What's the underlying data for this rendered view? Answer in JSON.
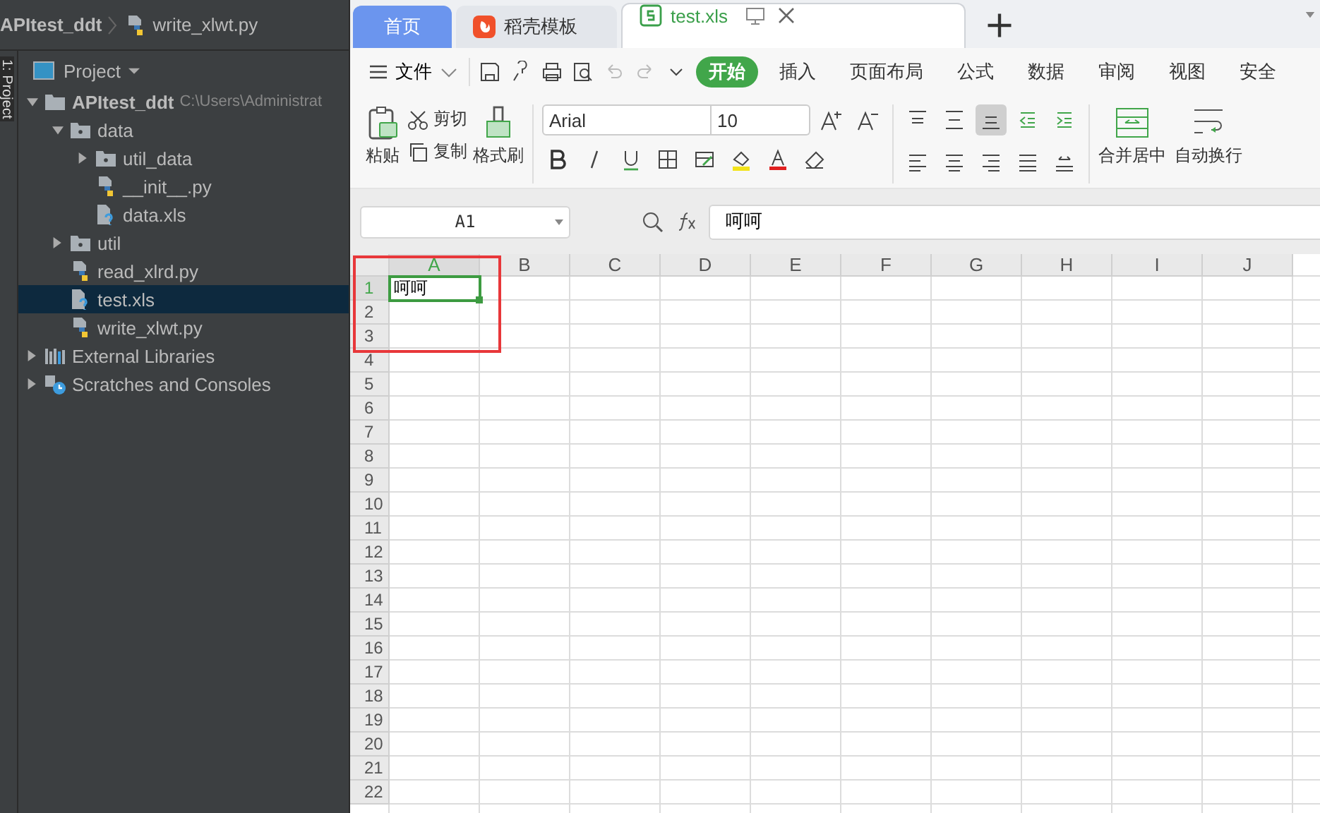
{
  "ide": {
    "breadcrumb": [
      "APItest_ddt",
      "write_xlwt.py"
    ],
    "side_tab": "1: Project",
    "panel_title": "Project",
    "tree": [
      {
        "label": "APItest_ddt",
        "kind": "project",
        "path": "C:\\Users\\Administrat",
        "expanded": true,
        "selected": false,
        "children": [
          {
            "label": "data",
            "kind": "folder",
            "expanded": true,
            "selected": false,
            "children": [
              {
                "label": "util_data",
                "kind": "folder",
                "expanded": false,
                "selected": false
              },
              {
                "label": "__init__.py",
                "kind": "python",
                "selected": false
              },
              {
                "label": "data.xls",
                "kind": "unknown",
                "selected": false
              }
            ]
          },
          {
            "label": "util",
            "kind": "folder",
            "expanded": false,
            "selected": false
          },
          {
            "label": "read_xlrd.py",
            "kind": "python",
            "selected": false
          },
          {
            "label": "test.xls",
            "kind": "unknown",
            "selected": true
          },
          {
            "label": "write_xlwt.py",
            "kind": "python",
            "selected": false
          }
        ]
      },
      {
        "label": "External Libraries",
        "kind": "libraries",
        "expanded": false,
        "selected": false
      },
      {
        "label": "Scratches and Consoles",
        "kind": "scratches",
        "expanded": false,
        "selected": false
      }
    ]
  },
  "wps": {
    "tabs": [
      {
        "label": "首页",
        "kind": "home",
        "selected": false
      },
      {
        "label": "稻壳模板",
        "kind": "template",
        "selected": false
      },
      {
        "label": "test.xls",
        "kind": "sheet",
        "selected": true
      }
    ],
    "file_menu": "文件",
    "ribbon_tabs": [
      {
        "label": "开始",
        "selected": true
      },
      {
        "label": "插入",
        "selected": false
      },
      {
        "label": "页面布局",
        "selected": false
      },
      {
        "label": "公式",
        "selected": false
      },
      {
        "label": "数据",
        "selected": false
      },
      {
        "label": "审阅",
        "selected": false
      },
      {
        "label": "视图",
        "selected": false
      },
      {
        "label": "安全",
        "selected": false
      }
    ],
    "clipboard": {
      "paste": "粘贴",
      "cut": "剪切",
      "copy": "复制",
      "format_painter": "格式刷"
    },
    "font": {
      "name": "Arial",
      "size": "10"
    },
    "align_buttons": [
      {
        "kind": "top",
        "selected": false
      },
      {
        "kind": "middle",
        "selected": false
      },
      {
        "kind": "bottom",
        "selected": true
      },
      {
        "kind": "outdent",
        "selected": false
      },
      {
        "kind": "indent",
        "selected": false
      },
      {
        "kind": "left",
        "selected": false
      },
      {
        "kind": "center",
        "selected": false
      },
      {
        "kind": "right",
        "selected": false
      },
      {
        "kind": "justify",
        "selected": false
      },
      {
        "kind": "distribute",
        "selected": false
      }
    ],
    "merge": "合并居中",
    "wrap": "自动换行",
    "name_box": "A1",
    "formula": "呵呵",
    "columns": [
      {
        "label": "A",
        "selected": true
      },
      {
        "label": "B",
        "selected": false
      },
      {
        "label": "C",
        "selected": false
      },
      {
        "label": "D",
        "selected": false
      },
      {
        "label": "E",
        "selected": false
      },
      {
        "label": "F",
        "selected": false
      },
      {
        "label": "G",
        "selected": false
      },
      {
        "label": "H",
        "selected": false
      },
      {
        "label": "I",
        "selected": false
      },
      {
        "label": "J",
        "selected": false
      }
    ],
    "rows": [
      {
        "label": "1",
        "selected": true,
        "cells": [
          {
            "text": "呵呵",
            "selected": true
          }
        ]
      },
      {
        "label": "2",
        "selected": false
      },
      {
        "label": "3",
        "selected": false
      },
      {
        "label": "4",
        "selected": false
      },
      {
        "label": "5",
        "selected": false
      },
      {
        "label": "6",
        "selected": false
      },
      {
        "label": "7",
        "selected": false
      },
      {
        "label": "8",
        "selected": false
      },
      {
        "label": "9",
        "selected": false
      },
      {
        "label": "10",
        "selected": false
      },
      {
        "label": "11",
        "selected": false
      },
      {
        "label": "12",
        "selected": false
      },
      {
        "label": "13",
        "selected": false
      },
      {
        "label": "14",
        "selected": false
      },
      {
        "label": "15",
        "selected": false
      },
      {
        "label": "16",
        "selected": false
      },
      {
        "label": "17",
        "selected": false
      },
      {
        "label": "18",
        "selected": false
      },
      {
        "label": "19",
        "selected": false
      },
      {
        "label": "20",
        "selected": false
      },
      {
        "label": "21",
        "selected": false
      },
      {
        "label": "22",
        "selected": false
      }
    ]
  }
}
